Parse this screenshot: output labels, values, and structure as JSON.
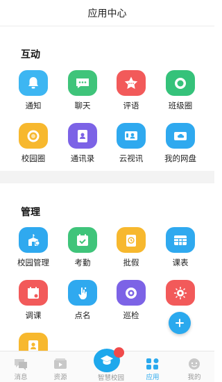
{
  "header": {
    "title": "应用中心"
  },
  "sections": {
    "interact": {
      "title": "互动"
    },
    "manage": {
      "title": "管理"
    }
  },
  "apps": {
    "notice": {
      "label": "通知",
      "color": "#3db6f2"
    },
    "chat": {
      "label": "聊天",
      "color": "#3fc47a"
    },
    "review": {
      "label": "评语",
      "color": "#f25a5a"
    },
    "class_circle": {
      "label": "班级圈",
      "color": "#35c27a"
    },
    "campus_circle": {
      "label": "校园圈",
      "color": "#f7b82e"
    },
    "contacts": {
      "label": "通讯录",
      "color": "#7c63e6"
    },
    "cloud_video": {
      "label": "云视讯",
      "color": "#2fa9ef"
    },
    "my_disk": {
      "label": "我的网盘",
      "color": "#2fa9ef"
    },
    "campus_manage": {
      "label": "校园管理",
      "color": "#2fa9ef"
    },
    "attendance": {
      "label": "考勤",
      "color": "#3fc47a"
    },
    "leave": {
      "label": "批假",
      "color": "#f7b82e"
    },
    "schedule": {
      "label": "课表",
      "color": "#2fa9ef"
    },
    "adjust_class": {
      "label": "调课",
      "color": "#f25a5a"
    },
    "roll_call": {
      "label": "点名",
      "color": "#2fa9ef"
    },
    "patrol": {
      "label": "巡检",
      "color": "#7c63e6"
    },
    "virus": {
      "color": "#f25a5a"
    },
    "extra": {
      "color": "#f7b82e"
    }
  },
  "tabbar": {
    "messages": "消息",
    "resources": "资源",
    "smart_campus": "智慧校园",
    "apps": "应用",
    "mine": "我的",
    "active_color": "#2aa9ee"
  }
}
